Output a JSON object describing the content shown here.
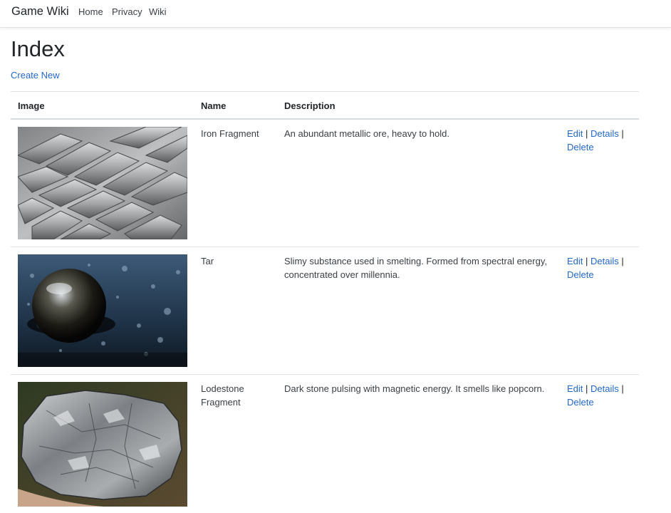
{
  "navbar": {
    "brand": "Game Wiki",
    "links": [
      "Home",
      "Privacy",
      "Wiki"
    ]
  },
  "page": {
    "title": "Index",
    "create_link": "Create New"
  },
  "table": {
    "headers": [
      "Image",
      "Name",
      "Description"
    ],
    "rows": [
      {
        "image": "silver-ingots-photo",
        "name": "Iron Fragment",
        "description": "An abundant metallic ore, heavy to hold."
      },
      {
        "image": "tar-bubble-photo",
        "name": "Tar",
        "description": "Slimy substance used in smelting. Formed from spectral energy, concentrated over millennia."
      },
      {
        "image": "lodestone-rock-photo",
        "name": "Lodestone Fragment",
        "description": "Dark stone pulsing with magnetic energy. It smells like popcorn."
      }
    ],
    "actions": {
      "edit": "Edit",
      "details": "Details",
      "delete": "Delete",
      "separator": "|"
    }
  },
  "colors": {
    "link": "#2468c9",
    "text": "#212529",
    "border": "#dee2e6"
  }
}
